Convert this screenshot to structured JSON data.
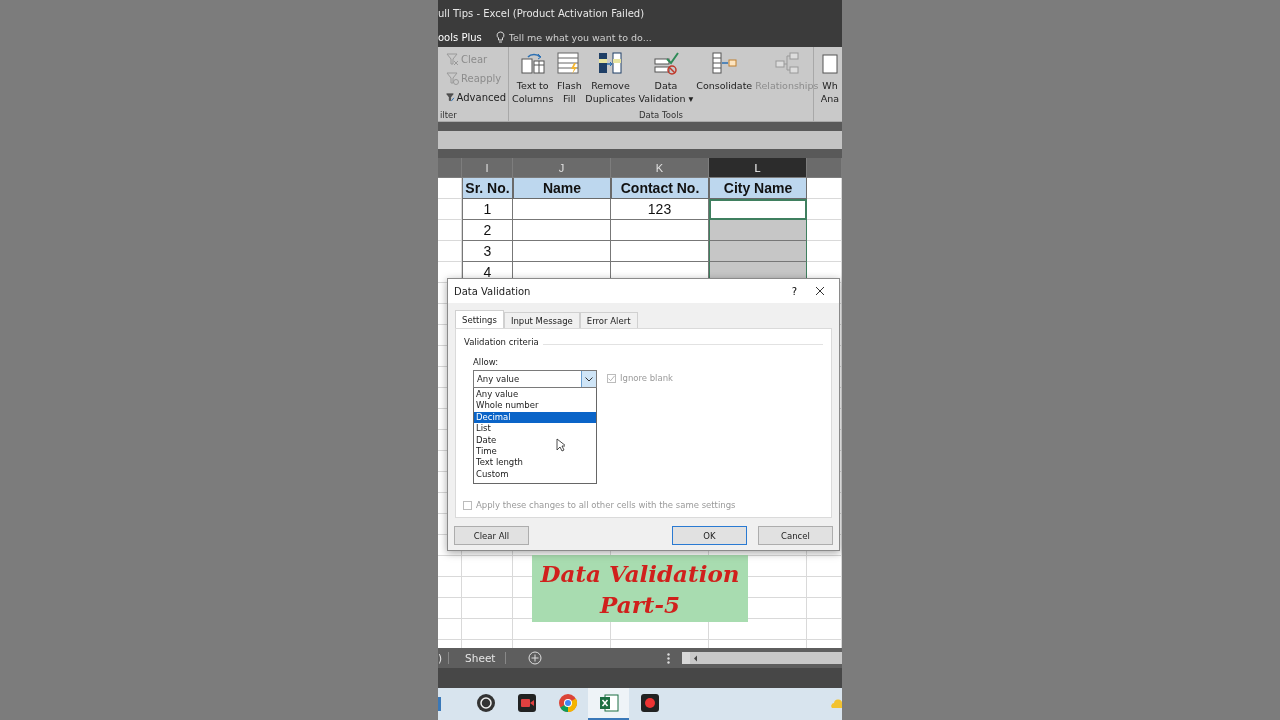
{
  "window": {
    "title": "ull Tips - Excel (Product Activation Failed)"
  },
  "ribbon_tabs": {
    "tab": "ools Plus",
    "tell_me": {
      "placeholder": "Tell me what you want to do..."
    }
  },
  "ribbon": {
    "groups": [
      {
        "label": "ilter",
        "kind": "small",
        "commands": [
          {
            "label": "Clear",
            "kind": "clear",
            "disabled": true
          },
          {
            "label": "Reapply",
            "kind": "reapply",
            "disabled": true
          },
          {
            "label": "Advanced",
            "kind": "advanced",
            "disabled": false
          }
        ]
      },
      {
        "label": "Data Tools",
        "kind": "large",
        "commands": [
          {
            "lines": [
              "Text to",
              "Columns"
            ],
            "kind": "text-to-columns",
            "disabled": false
          },
          {
            "lines": [
              "Flash",
              "Fill"
            ],
            "kind": "flash-fill",
            "disabled": false
          },
          {
            "lines": [
              "Remove",
              "Duplicates"
            ],
            "kind": "remove-duplicates",
            "disabled": false
          },
          {
            "lines": [
              "Data",
              "Validation"
            ],
            "kind": "data-validation",
            "disabled": false,
            "caret": "▾"
          },
          {
            "lines": [
              "Consolidate"
            ],
            "kind": "consolidate",
            "disabled": false
          },
          {
            "lines": [
              "Relationships"
            ],
            "kind": "relationships",
            "disabled": true
          }
        ]
      },
      {
        "kind": "large",
        "commands": [
          {
            "lines": [
              "Wh",
              "Ana"
            ],
            "kind": "what-if",
            "disabled": false
          }
        ]
      }
    ]
  },
  "sheet": {
    "columns": [
      {
        "label": "I",
        "selected": false
      },
      {
        "label": "J",
        "selected": false
      },
      {
        "label": "K",
        "selected": false
      },
      {
        "label": "L",
        "selected": true
      }
    ],
    "header": [
      "Sr. No.",
      "Name",
      "Contact No.",
      "City Name"
    ],
    "rows": [
      {
        "sr_no": "1",
        "contact_no": "123",
        "city_selected": false
      },
      {
        "sr_no": "2",
        "city_selected": true
      },
      {
        "sr_no": "3",
        "city_selected": true
      },
      {
        "sr_no": "4",
        "city_selected": true
      }
    ]
  },
  "banner": {
    "lines": [
      "Data Validation",
      "Part-5"
    ]
  },
  "dialog": {
    "title": "Data Validation",
    "help": "?",
    "tabs": [
      {
        "label": "Settings",
        "selected": true
      },
      {
        "label": "Input Message",
        "selected": false
      },
      {
        "label": "Error Alert",
        "selected": false
      }
    ],
    "section": "Validation criteria",
    "allow_label": "Allow:",
    "allow_value": "Any value",
    "options": [
      {
        "label": "Any value",
        "selected": false
      },
      {
        "label": "Whole number",
        "selected": false
      },
      {
        "label": "Decimal",
        "selected": true
      },
      {
        "label": "List",
        "selected": false
      },
      {
        "label": "Date",
        "selected": false
      },
      {
        "label": "Time",
        "selected": false
      },
      {
        "label": "Text length",
        "selected": false
      },
      {
        "label": "Custom",
        "selected": false
      }
    ],
    "ignore_blank": {
      "label": "Ignore blank",
      "checked": true,
      "disabled": true
    },
    "apply_all": {
      "label": "Apply these changes to all other cells with the same settings",
      "checked": false,
      "disabled": true
    },
    "buttons": [
      {
        "label": "Clear All",
        "default": false
      },
      {
        "label": "OK",
        "default": true
      },
      {
        "label": "Cancel",
        "default": false
      }
    ]
  },
  "sheet_tabs": {
    "partial": ")",
    "tabs": [
      {
        "label": "Sheet",
        "selected": false
      }
    ]
  },
  "taskbar": {
    "apps": [
      {
        "kind": "obs",
        "selected": false
      },
      {
        "kind": "recorder",
        "selected": false
      },
      {
        "kind": "chrome",
        "selected": false
      },
      {
        "kind": "excel",
        "selected": true
      },
      {
        "kind": "camera",
        "selected": false
      }
    ]
  }
}
